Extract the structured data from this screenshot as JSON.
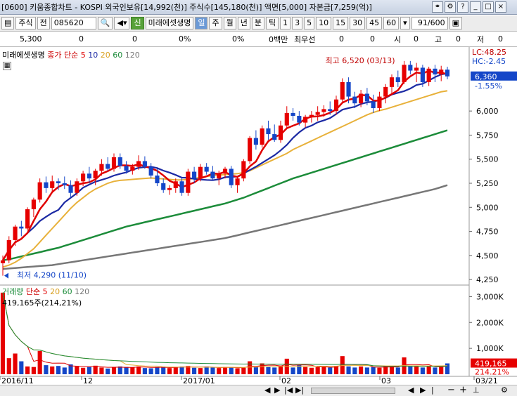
{
  "window": {
    "title": "[0600] 키움종합차트 - KOSPI 외국인보유[14,992(천)] 주식수[145,180(천)] 액면[5,000] 자본금[7,259(억)]"
  },
  "toolbar": {
    "market": "주식",
    "mode": "전",
    "code": "085620",
    "badge": "신",
    "company": "미래에셋생명",
    "periods": [
      "일",
      "주",
      "월",
      "년",
      "분",
      "틱"
    ],
    "minutes": [
      "1",
      "3",
      "5",
      "10",
      "15",
      "30",
      "45",
      "60"
    ],
    "counter": "91/600"
  },
  "infoline": {
    "price": "5,300",
    "v1": "0",
    "v2": "0",
    "v3": "0%",
    "v4": "0%",
    "v5": "0백만",
    "v6": "최우선",
    "v7": "0",
    "v8": "0",
    "v9": "시",
    "v10": "0",
    "v11": "고",
    "v12": "0",
    "v13": "저",
    "v14": "0"
  },
  "legend_price": {
    "name": "미래에셋생명",
    "close": "종가",
    "type": "단순",
    "ma": [
      "5",
      "10",
      "20",
      "60",
      "120"
    ],
    "ma_colors": [
      "#e00000",
      "#1c2aa4",
      "#e8b13a",
      "#1c8c3a",
      "#777777"
    ]
  },
  "legend_volume": {
    "name": "거래량",
    "type": "단순",
    "ma": [
      "5",
      "20",
      "60",
      "120"
    ],
    "value": "419,165주(214,21%)"
  },
  "annotations": {
    "high": "최고 6,520 (03/13)",
    "low": "최저 4,290 (11/10)"
  },
  "price_panel": {
    "lc": "LC:48.25",
    "hc": "HC:-2.45",
    "last": "6,360",
    "pct": "-1.55%",
    "y_ticks": [
      "6,000",
      "5,750",
      "5,500",
      "5,250",
      "5,000",
      "4,750",
      "4,500",
      "4,250"
    ]
  },
  "volume_panel": {
    "y_ticks": [
      "3,000K",
      "2,000K",
      "1,000K"
    ],
    "last": "419,165",
    "pct": "214.21%"
  },
  "x_labels": [
    "2016/11",
    "12",
    "2017/01",
    "02",
    "03",
    "03/21"
  ],
  "colors": {
    "up": "#e60000",
    "down": "#1446c8",
    "ma5": "#e00000",
    "ma10": "#1c2aa4",
    "ma20": "#e8b13a",
    "ma60": "#1c8c3a",
    "ma120": "#777777",
    "axis_bg": "#ffffff",
    "last_label": "#1446c8"
  },
  "chart_data": [
    {
      "type": "candlestick",
      "title": "미래에셋생명",
      "ylim": [
        4200,
        6650
      ],
      "candles": [
        [
          4420,
          4500,
          4290,
          4450
        ],
        [
          4450,
          4700,
          4420,
          4660
        ],
        [
          4660,
          4820,
          4600,
          4800
        ],
        [
          4800,
          4860,
          4700,
          4780
        ],
        [
          4780,
          5000,
          4760,
          4980
        ],
        [
          4980,
          5100,
          4900,
          5080
        ],
        [
          5080,
          5300,
          5050,
          5260
        ],
        [
          5260,
          5320,
          5150,
          5200
        ],
        [
          5200,
          5330,
          5150,
          5270
        ],
        [
          5270,
          5300,
          5180,
          5250
        ],
        [
          5250,
          5320,
          5190,
          5230
        ],
        [
          5230,
          5280,
          5100,
          5150
        ],
        [
          5150,
          5300,
          5120,
          5270
        ],
        [
          5270,
          5380,
          5220,
          5350
        ],
        [
          5350,
          5420,
          5250,
          5300
        ],
        [
          5300,
          5400,
          5230,
          5380
        ],
        [
          5380,
          5500,
          5330,
          5450
        ],
        [
          5450,
          5520,
          5380,
          5400
        ],
        [
          5400,
          5560,
          5370,
          5520
        ],
        [
          5520,
          5560,
          5400,
          5430
        ],
        [
          5430,
          5480,
          5350,
          5380
        ],
        [
          5380,
          5450,
          5340,
          5420
        ],
        [
          5420,
          5540,
          5390,
          5480
        ],
        [
          5480,
          5530,
          5400,
          5420
        ],
        [
          5420,
          5460,
          5300,
          5330
        ],
        [
          5330,
          5400,
          5220,
          5250
        ],
        [
          5250,
          5300,
          5150,
          5180
        ],
        [
          5180,
          5230,
          5130,
          5200
        ],
        [
          5200,
          5300,
          5150,
          5270
        ],
        [
          5270,
          5310,
          5120,
          5150
        ],
        [
          5150,
          5400,
          5120,
          5370
        ],
        [
          5370,
          5420,
          5250,
          5300
        ],
        [
          5300,
          5450,
          5270,
          5420
        ],
        [
          5420,
          5460,
          5340,
          5370
        ],
        [
          5370,
          5430,
          5280,
          5300
        ],
        [
          5300,
          5380,
          5230,
          5350
        ],
        [
          5350,
          5420,
          5300,
          5400
        ],
        [
          5400,
          5430,
          5200,
          5230
        ],
        [
          5230,
          5320,
          5150,
          5300
        ],
        [
          5300,
          5500,
          5270,
          5480
        ],
        [
          5480,
          5740,
          5450,
          5720
        ],
        [
          5720,
          5800,
          5600,
          5650
        ],
        [
          5650,
          5850,
          5620,
          5820
        ],
        [
          5820,
          5900,
          5700,
          5760
        ],
        [
          5760,
          5860,
          5680,
          5700
        ],
        [
          5700,
          5900,
          5670,
          5850
        ],
        [
          5850,
          6050,
          5820,
          5980
        ],
        [
          5980,
          6030,
          5900,
          5950
        ],
        [
          5950,
          6000,
          5850,
          5880
        ],
        [
          5880,
          5960,
          5830,
          5940
        ],
        [
          5940,
          6000,
          5880,
          5960
        ],
        [
          5960,
          6050,
          5900,
          5990
        ],
        [
          5990,
          6060,
          5940,
          6020
        ],
        [
          6020,
          6100,
          5960,
          6000
        ],
        [
          6000,
          6160,
          5960,
          6120
        ],
        [
          6120,
          6340,
          6080,
          6300
        ],
        [
          6300,
          6350,
          6080,
          6150
        ],
        [
          6150,
          6200,
          6030,
          6080
        ],
        [
          6080,
          6220,
          6040,
          6180
        ],
        [
          6180,
          6240,
          6060,
          6100
        ],
        [
          6100,
          6170,
          5980,
          6030
        ],
        [
          6030,
          6200,
          6000,
          6150
        ],
        [
          6150,
          6280,
          6080,
          6250
        ],
        [
          6250,
          6380,
          6180,
          6350
        ],
        [
          6350,
          6420,
          6250,
          6300
        ],
        [
          6300,
          6520,
          6280,
          6480
        ],
        [
          6480,
          6520,
          6380,
          6420
        ],
        [
          6420,
          6500,
          6300,
          6450
        ],
        [
          6450,
          6480,
          6250,
          6300
        ],
        [
          6300,
          6460,
          6260,
          6440
        ],
        [
          6440,
          6480,
          6300,
          6380
        ],
        [
          6380,
          6470,
          6310,
          6430
        ],
        [
          6430,
          6460,
          6330,
          6360
        ]
      ],
      "ma20": [
        4380,
        4400,
        4430,
        4470,
        4520,
        4570,
        4640,
        4710,
        4780,
        4850,
        4920,
        4990,
        5050,
        5100,
        5150,
        5190,
        5220,
        5250,
        5270,
        5280,
        5285,
        5290,
        5295,
        5300,
        5305,
        5300,
        5295,
        5290,
        5285,
        5285,
        5290,
        5300,
        5310,
        5320,
        5330,
        5335,
        5340,
        5345,
        5350,
        5360,
        5380,
        5410,
        5440,
        5470,
        5500,
        5530,
        5560,
        5600,
        5630,
        5660,
        5690,
        5720,
        5750,
        5780,
        5810,
        5840,
        5870,
        5900,
        5930,
        5960,
        5985,
        6005,
        6020,
        6040,
        6060,
        6080,
        6100,
        6120,
        6140,
        6160,
        6180,
        6200,
        6210
      ],
      "ma60": [
        4450,
        4460,
        4475,
        4490,
        4505,
        4520,
        4535,
        4550,
        4565,
        4580,
        4600,
        4620,
        4640,
        4660,
        4680,
        4700,
        4720,
        4740,
        4760,
        4780,
        4800,
        4815,
        4830,
        4845,
        4860,
        4875,
        4890,
        4905,
        4920,
        4935,
        4950,
        4965,
        4980,
        4995,
        5010,
        5025,
        5040,
        5060,
        5080,
        5100,
        5125,
        5150,
        5175,
        5200,
        5225,
        5250,
        5275,
        5300,
        5320,
        5340,
        5360,
        5380,
        5400,
        5420,
        5440,
        5460,
        5480,
        5500,
        5520,
        5540,
        5560,
        5580,
        5600,
        5620,
        5640,
        5660,
        5680,
        5700,
        5720,
        5740,
        5760,
        5780,
        5800
      ],
      "ma120": [
        4360,
        4365,
        4370,
        4375,
        4380,
        4385,
        4390,
        4395,
        4400,
        4410,
        4420,
        4430,
        4440,
        4450,
        4460,
        4470,
        4480,
        4490,
        4500,
        4510,
        4520,
        4530,
        4540,
        4550,
        4560,
        4570,
        4580,
        4590,
        4600,
        4610,
        4620,
        4630,
        4640,
        4650,
        4660,
        4670,
        4680,
        4695,
        4710,
        4725,
        4740,
        4755,
        4770,
        4785,
        4800,
        4815,
        4830,
        4845,
        4860,
        4875,
        4890,
        4905,
        4920,
        4935,
        4950,
        4965,
        4980,
        4995,
        5010,
        5025,
        5040,
        5055,
        5070,
        5085,
        5100,
        5115,
        5130,
        5145,
        5160,
        5175,
        5190,
        5210,
        5230
      ]
    },
    {
      "type": "bar",
      "title": "거래량",
      "ylim": [
        0,
        3200000
      ],
      "values": [
        3150000,
        620000,
        800000,
        500000,
        300000,
        280000,
        900000,
        350000,
        300000,
        320000,
        260000,
        380000,
        300000,
        250000,
        280000,
        330000,
        260000,
        220000,
        260000,
        300000,
        280000,
        260000,
        300000,
        240000,
        230000,
        280000,
        300000,
        240000,
        270000,
        300000,
        320000,
        250000,
        240000,
        300000,
        260000,
        240000,
        280000,
        260000,
        230000,
        250000,
        500000,
        280000,
        420000,
        300000,
        260000,
        330000,
        600000,
        260000,
        350000,
        280000,
        250000,
        270000,
        300000,
        260000,
        320000,
        700000,
        300000,
        260000,
        300000,
        260000,
        280000,
        250000,
        300000,
        320000,
        260000,
        650000,
        330000,
        300000,
        260000,
        300000,
        260000,
        300000,
        419165
      ]
    }
  ]
}
